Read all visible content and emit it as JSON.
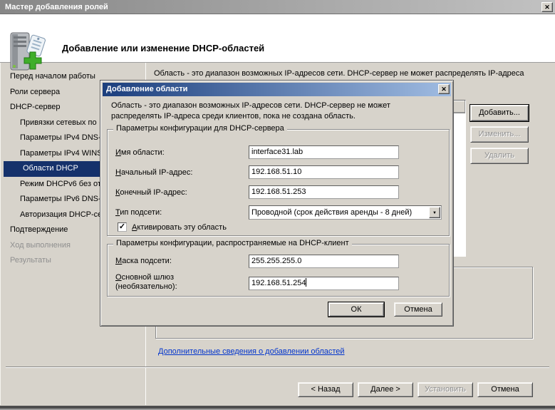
{
  "window": {
    "title": "Мастер добавления ролей"
  },
  "header": {
    "title": "Добавление или изменение DHCP-областей"
  },
  "icons": {
    "close": "✕",
    "dropdown": "▼",
    "check": "✓"
  },
  "sidebar": {
    "items": [
      {
        "label": "Перед началом работы",
        "indent": 0,
        "state": "normal"
      },
      {
        "label": "Роли сервера",
        "indent": 0,
        "state": "normal"
      },
      {
        "label": "DHCP-сервер",
        "indent": 0,
        "state": "normal"
      },
      {
        "label": "Привязки сетевых по",
        "indent": 1,
        "state": "normal"
      },
      {
        "label": "Параметры IPv4 DNS-",
        "indent": 1,
        "state": "normal"
      },
      {
        "label": "Параметры IPv4 WINS",
        "indent": 1,
        "state": "normal"
      },
      {
        "label": "Области DHCP",
        "indent": 1,
        "state": "selected"
      },
      {
        "label": "Режим DHCPv6 без от",
        "indent": 1,
        "state": "normal"
      },
      {
        "label": "Параметры IPv6 DNS-",
        "indent": 1,
        "state": "normal"
      },
      {
        "label": "Авторизация DHCP-се",
        "indent": 1,
        "state": "normal"
      },
      {
        "label": "Подтверждение",
        "indent": 0,
        "state": "normal"
      },
      {
        "label": "Ход выполнения",
        "indent": 0,
        "state": "disabled"
      },
      {
        "label": "Результаты",
        "indent": 0,
        "state": "disabled"
      }
    ]
  },
  "main": {
    "intro": "Область - это диапазон возможных IP-адресов сети. DHCP-сервер не может распределять IP-адреса",
    "add_button": "Добавить...",
    "edit_button": "Изменить...",
    "delete_button": "Удалить",
    "help_link": "Дополнительные сведения о добавлении областей"
  },
  "footer": {
    "back": "< Назад",
    "next": "Далее >",
    "install": "Установить",
    "cancel": "Отмена"
  },
  "dialog": {
    "title": "Добавление области",
    "intro": "Область - это диапазон возможных IP-адресов сети. DHCP-сервер не может распределять IP-адреса среди клиентов, пока не создана область.",
    "group1": {
      "title": "Параметры конфигурации для DHCP-сервера",
      "scope_name": {
        "label": "Имя области:",
        "value": "interface31.lab"
      },
      "start_ip": {
        "label": "Начальный IP-адрес:",
        "value": "192.168.51.10"
      },
      "end_ip": {
        "label": "Конечный IP-адрес:",
        "value": "192.168.51.253"
      },
      "subnet_type": {
        "label": "Тип подсети:",
        "value": "Проводной (срок действия аренды - 8 дней)"
      },
      "activate": {
        "label": "Активировать эту область",
        "checked": true
      }
    },
    "group2": {
      "title": "Параметры конфигурации, распространяемые на DHCP-клиент",
      "subnet_mask": {
        "label": "Маска подсети:",
        "value": "255.255.255.0"
      },
      "gateway": {
        "label": "Основной шлюз (необязательно):",
        "value": "192.168.51.254"
      }
    },
    "ok": "ОК",
    "cancel": "Отмена"
  },
  "colors": {
    "selection": "#15316b",
    "dialog_title_from": "#1b3e7d",
    "dialog_title_to": "#a0bce2",
    "link": "#0033cc",
    "chrome": "#d7d3cb"
  }
}
